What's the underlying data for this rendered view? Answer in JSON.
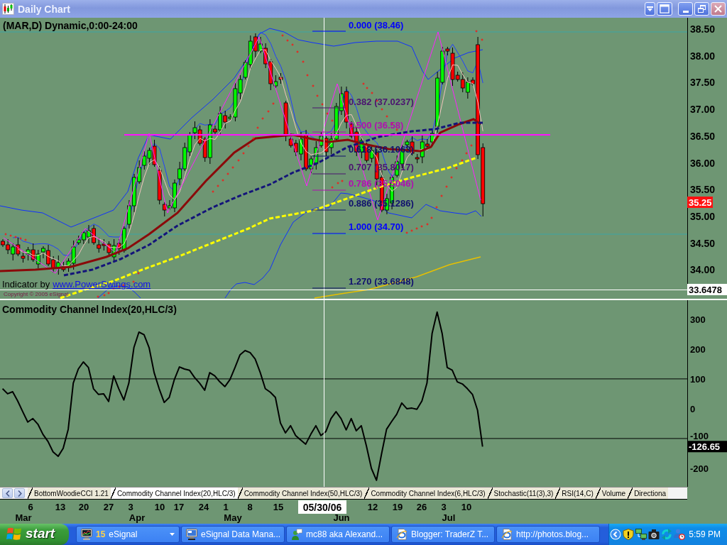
{
  "window": {
    "title": "Daily Chart"
  },
  "price_panel": {
    "header": "(MAR,D) Dynamic,0:00-24:00",
    "fib_levels": [
      {
        "label": "0.000 (38.46)",
        "color": "#0000ff"
      },
      {
        "label": "0.382 (37.0237)",
        "color": "#4b1470"
      },
      {
        "label": "0.500 (36.58)",
        "color": "#b010b0"
      },
      {
        "label": "0.618 (36.1063)",
        "color": "#10106e"
      },
      {
        "label": "0.707 (35.8017)",
        "color": "#4b1470"
      },
      {
        "label": "0.786 (35.5046)",
        "color": "#b010b0"
      },
      {
        "label": "0.886 (35.1286)",
        "color": "#10106e"
      },
      {
        "label": "1.000 (34.70)",
        "color": "#0000ff"
      },
      {
        "label": "1.270 (33.6848)",
        "color": "#10106e"
      }
    ],
    "axis_labels": [
      "38.50",
      "38.00",
      "37.50",
      "37.00",
      "36.50",
      "36.00",
      "35.50",
      "35.00",
      "34.50",
      "34.00"
    ],
    "last_price": "35.25",
    "crosshair_price": "33.6478",
    "credit": {
      "text": "Indicator by",
      "link": "www.PowerSwings.com"
    },
    "copyright": "Copyright © 2005 eSignal"
  },
  "cci_panel": {
    "chart_data": {
      "type": "line",
      "title": "Commodity Channel Index(20,HLC/3)",
      "series": [
        {
          "color": "#000000",
          "values": [
            67,
            50,
            57,
            26,
            -10,
            -45,
            -33,
            -52,
            -86,
            -110,
            -145,
            -160,
            -133,
            -69,
            86,
            133,
            157,
            138,
            67,
            48,
            50,
            24,
            110,
            67,
            29,
            86,
            205,
            257,
            248,
            205,
            121,
            67,
            21,
            38,
            98,
            140,
            133,
            129,
            105,
            86,
            62,
            121,
            110,
            90,
            74,
            98,
            138,
            181,
            195,
            188,
            167,
            121,
            67,
            55,
            38,
            -48,
            -81,
            -57,
            -90,
            -105,
            -119,
            -86,
            -57,
            -90,
            -76,
            -33,
            -10,
            -33,
            -71,
            -33,
            -74,
            -57,
            -124,
            -200,
            -240,
            -152,
            -69,
            -43,
            -19,
            19,
            0,
            2,
            -2,
            26,
            86,
            252,
            324,
            252,
            138,
            129,
            90,
            83,
            67,
            48,
            -5,
            -127,
            null,
            null,
            null,
            null,
            null,
            null,
            null,
            null,
            null,
            null,
            null,
            null,
            null,
            null,
            null,
            null,
            null,
            null,
            null,
            null,
            null,
            null,
            null,
            null,
            null,
            null,
            null,
            null,
            null,
            null,
            null,
            null,
            null,
            null,
            null,
            null,
            null,
            null,
            null,
            null
          ]
        }
      ],
      "ylim": [
        -262,
        364
      ],
      "yticks": [
        300,
        200,
        100,
        0,
        -100,
        -200
      ],
      "ref_lines": [
        {
          "axis": "y",
          "value": 100
        },
        {
          "axis": "y",
          "value": -100
        }
      ]
    },
    "last_value": "-126.65"
  },
  "tabs": [
    {
      "label": "BottomWoodieCCI 1.21",
      "selected": false
    },
    {
      "label": "Commodity Channel Index(20,HLC/3)",
      "selected": true
    },
    {
      "label": "Commodity Channel Index(50,HLC/3)",
      "selected": false
    },
    {
      "label": "Commodity Channel Index(6,HLC/3)",
      "selected": false
    },
    {
      "label": "Stochastic(11(3),3)",
      "selected": false
    },
    {
      "label": "RSI(14,C)",
      "selected": false
    },
    {
      "label": "Volume",
      "selected": false
    },
    {
      "label": "Directiona",
      "selected": false
    }
  ],
  "date_axis": {
    "days": [
      "6",
      "13",
      "20",
      "27",
      "3",
      "10",
      "17",
      "24",
      "1",
      "8",
      "15",
      "12",
      "19",
      "26",
      "3",
      "10"
    ],
    "months": [
      "Mar",
      "Apr",
      "May",
      "Jun",
      "Jul"
    ],
    "crosshair_date": "05/30/06"
  },
  "taskbar": {
    "start": "start",
    "buttons": [
      {
        "kind": "group",
        "count": "15",
        "label": "eSignal",
        "selected": false
      },
      {
        "kind": "window",
        "label": "eSignal Data Mana...",
        "selected": false
      },
      {
        "kind": "window",
        "label": "mc88 aka Alexand...",
        "selected": false
      },
      {
        "kind": "window",
        "label": "Blogger: TraderZ T...",
        "selected": false
      },
      {
        "kind": "window",
        "label": "http://photos.blog...",
        "selected": false
      }
    ],
    "clock": "5:59 PM"
  }
}
